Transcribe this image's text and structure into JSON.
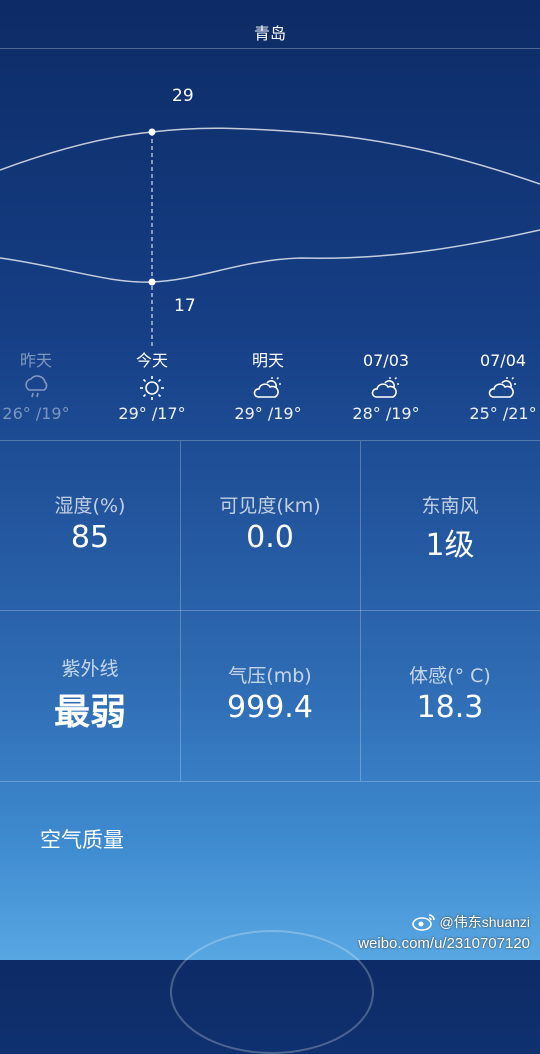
{
  "header": {
    "city": "青岛"
  },
  "chart_data": {
    "type": "line",
    "series": [
      {
        "values": [
          29
        ]
      },
      {
        "values": [
          17
        ]
      }
    ],
    "highlight_high": "29",
    "highlight_low": "17"
  },
  "forecast": [
    {
      "name": "昨天",
      "icon": "rain-icon",
      "temps": "26°  /19°",
      "past": true
    },
    {
      "name": "今天",
      "icon": "sun-icon",
      "temps": "29°  /17°",
      "past": false
    },
    {
      "name": "明天",
      "icon": "partly-cloudy-icon",
      "temps": "29°  /19°",
      "past": false
    },
    {
      "name": "07/03",
      "icon": "partly-cloudy-icon",
      "temps": "28°  /19°",
      "past": false
    },
    {
      "name": "07/04",
      "icon": "partly-cloudy-icon",
      "temps": "25°  /21°",
      "past": false
    }
  ],
  "details": {
    "humidity_label": "湿度(%)",
    "humidity_value": "85",
    "visibility_label": "可见度(km)",
    "visibility_value": "0.0",
    "wind_label": "东南风",
    "wind_value": "1级",
    "uv_label": "紫外线",
    "uv_value": "最弱",
    "pressure_label": "气压(mb)",
    "pressure_value": "999.4",
    "feels_label": "体感(°  C)",
    "feels_value": "18.3"
  },
  "air_quality": {
    "label": "空气质量"
  },
  "watermark": {
    "handle": "@伟东shuanzi",
    "url": "weibo.com/u/2310707120"
  }
}
